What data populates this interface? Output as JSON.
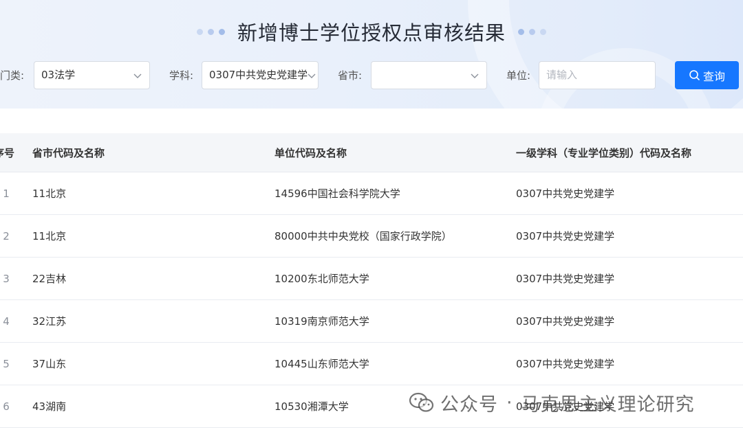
{
  "header": {
    "title": "新增博士学位授权点审核结果"
  },
  "filters": {
    "category_label": "门类:",
    "category_value": "03法学",
    "subject_label": "学科:",
    "subject_value": "0307中共党史党建学",
    "province_label": "省市:",
    "province_value": "",
    "unit_label": "单位:",
    "unit_placeholder": "请输入",
    "search_label": "查询"
  },
  "table": {
    "columns": [
      "序号",
      "省市代码及名称",
      "单位代码及名称",
      "一级学科（专业学位类别）代码及名称"
    ],
    "rows": [
      {
        "no": "1",
        "province": "11北京",
        "unit": "14596中国社会科学院大学",
        "subject": "0307中共党史党建学"
      },
      {
        "no": "2",
        "province": "11北京",
        "unit": "80000中共中央党校（国家行政学院）",
        "subject": "0307中共党史党建学"
      },
      {
        "no": "3",
        "province": "22吉林",
        "unit": "10200东北师范大学",
        "subject": "0307中共党史党建学"
      },
      {
        "no": "4",
        "province": "32江苏",
        "unit": "10319南京师范大学",
        "subject": "0307中共党史党建学"
      },
      {
        "no": "5",
        "province": "37山东",
        "unit": "10445山东师范大学",
        "subject": "0307中共党史党建学"
      },
      {
        "no": "6",
        "province": "43湖南",
        "unit": "10530湘潭大学",
        "subject": "0307中共党史党建学"
      }
    ]
  },
  "watermark": {
    "platform": "公众号",
    "separator": "·",
    "account": "马克思主义理论研究",
    "icon": "wechat-icon"
  },
  "colors": {
    "accent": "#1677ff",
    "header_bg": "#e9f0fb",
    "table_head_bg": "#f4f6f9"
  }
}
